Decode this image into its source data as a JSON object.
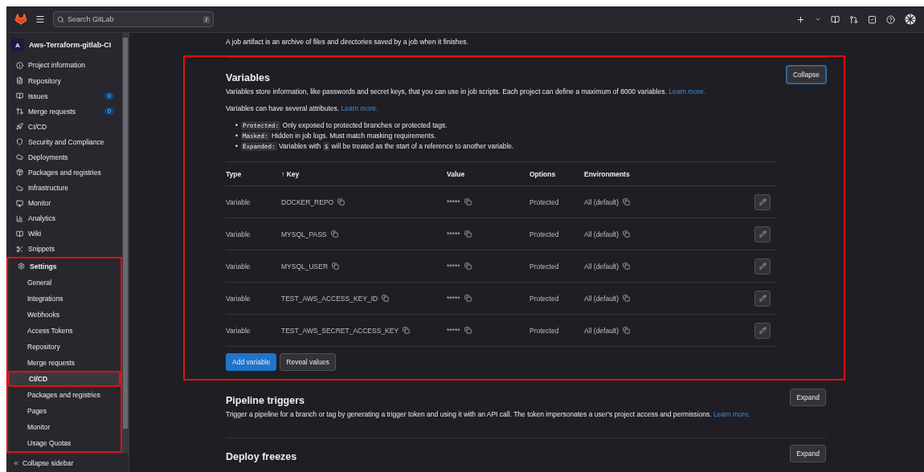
{
  "header": {
    "search": {
      "placeholder": "Search GitLab",
      "shortcut": "/"
    }
  },
  "sidebar": {
    "project": {
      "avatar": "A",
      "name": "Aws-Terraform-gitlab-CI"
    },
    "items": [
      {
        "label": "Project information",
        "selected": false
      },
      {
        "label": "Repository",
        "selected": false
      },
      {
        "label": "Issues",
        "badge": "0",
        "selected": false
      },
      {
        "label": "Merge requests",
        "badge": "0",
        "selected": false
      },
      {
        "label": "CI/CD",
        "selected": false
      },
      {
        "label": "Security and Compliance",
        "selected": false
      },
      {
        "label": "Deployments",
        "selected": false
      },
      {
        "label": "Packages and registries",
        "selected": false
      },
      {
        "label": "Infrastructure",
        "selected": false
      },
      {
        "label": "Monitor",
        "selected": false
      },
      {
        "label": "Analytics",
        "selected": false
      },
      {
        "label": "Wiki",
        "selected": false
      },
      {
        "label": "Snippets",
        "selected": false
      },
      {
        "label": "Settings",
        "selected": true,
        "expanded": true,
        "annotated": true,
        "children": [
          {
            "label": "General",
            "selected": false,
            "annotated": false
          },
          {
            "label": "Integrations",
            "selected": false,
            "annotated": false
          },
          {
            "label": "Webhooks",
            "selected": false,
            "annotated": false
          },
          {
            "label": "Access Tokens",
            "selected": false,
            "annotated": false
          },
          {
            "label": "Repository",
            "selected": false,
            "annotated": false
          },
          {
            "label": "Merge requests",
            "selected": false,
            "annotated": false
          },
          {
            "label": "CI/CD",
            "selected": true,
            "annotated": true
          },
          {
            "label": "Packages and registries",
            "selected": false,
            "annotated": false
          },
          {
            "label": "Pages",
            "selected": false,
            "annotated": false
          },
          {
            "label": "Monitor",
            "selected": false,
            "annotated": false
          },
          {
            "label": "Usage Quotas",
            "selected": false,
            "annotated": false
          }
        ]
      }
    ],
    "collapse": "Collapse sidebar"
  },
  "main": {
    "artifacts_note": "A job artifact is an archive of files and directories saved by a job when it finishes.",
    "variables": {
      "title": "Variables",
      "annotated": true,
      "toggle": "Collapse",
      "description": "Variables store information, like passwords and secret keys, that you can use in job scripts. Each project can define a maximum of 8000 variables.",
      "description_link": "Learn more.",
      "attributes_intro": "Variables can have several attributes.",
      "attributes_link": "Learn more.",
      "attributes": [
        {
          "bullet": "•",
          "term": "Protected:",
          "text": "Only exposed to protected branches or protected tags."
        },
        {
          "bullet": "•",
          "term": "Masked:",
          "text": "Hidden in job logs. Must match masking requirements."
        },
        {
          "bullet": "•",
          "term": "Expanded:",
          "text": "Variables with",
          "code": "$",
          "text_after": "will be treated as the start of a reference to another variable."
        }
      ],
      "table": {
        "columns": [
          {
            "label": "Type"
          },
          {
            "label": "Key",
            "sort_indicator": "↑"
          },
          {
            "label": "Value"
          },
          {
            "label": "Options"
          },
          {
            "label": "Environments"
          }
        ],
        "rows": [
          {
            "type": "Variable",
            "key": "DOCKER_REPO",
            "value": "*****",
            "options": "Protected",
            "environments": "All (default)"
          },
          {
            "type": "Variable",
            "key": "MYSQL_PASS",
            "value": "*****",
            "options": "Protected",
            "environments": "All (default)"
          },
          {
            "type": "Variable",
            "key": "MYSQL_USER",
            "value": "*****",
            "options": "Protected",
            "environments": "All (default)"
          },
          {
            "type": "Variable",
            "key": "TEST_AWS_ACCESS_KEY_ID",
            "value": "*****",
            "options": "Protected",
            "environments": "All (default)"
          },
          {
            "type": "Variable",
            "key": "TEST_AWS_SECRET_ACCESS_KEY",
            "value": "*****",
            "options": "Protected",
            "environments": "All (default)"
          }
        ]
      },
      "buttons": [
        {
          "label": "Add variable",
          "kind": "primary"
        },
        {
          "label": "Reveal values",
          "kind": "secondary"
        }
      ]
    },
    "sections": [
      {
        "title": "Pipeline triggers",
        "toggle": "Expand",
        "description": "Trigger a pipeline for a branch or tag by generating a trigger token and using it with an API call. The token impersonates a user's project access and permissions.",
        "link": "Learn more."
      },
      {
        "title": "Deploy freezes",
        "toggle": "Expand"
      }
    ]
  }
}
